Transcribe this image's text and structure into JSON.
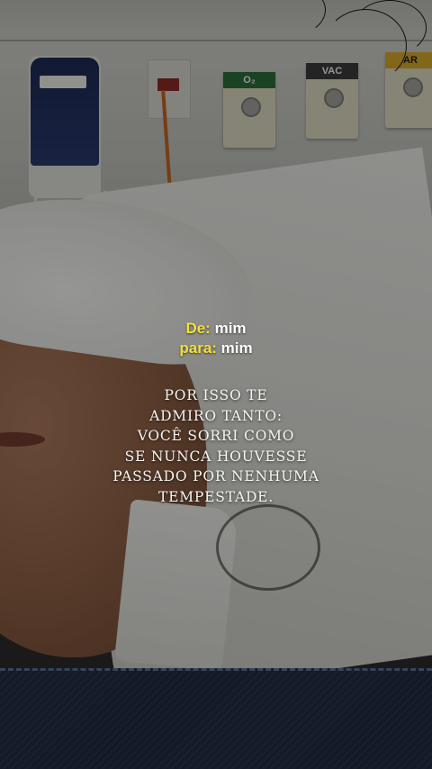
{
  "overlay": {
    "from_label": "De:",
    "from_value": "mim",
    "to_label": "para:",
    "to_value": "mim",
    "message_lines": [
      "POR ISSO TE",
      "ADMIRO TANTO:",
      "VOCÊ SORRI COMO",
      "SE NUNCA HOUVESSE",
      "PASSADO POR NENHUMA",
      "TEMPESTADE."
    ],
    "highlight_color": "#f3e03a"
  },
  "photo": {
    "outlet_labels": [
      "O₂",
      "VAC",
      "AR"
    ]
  }
}
